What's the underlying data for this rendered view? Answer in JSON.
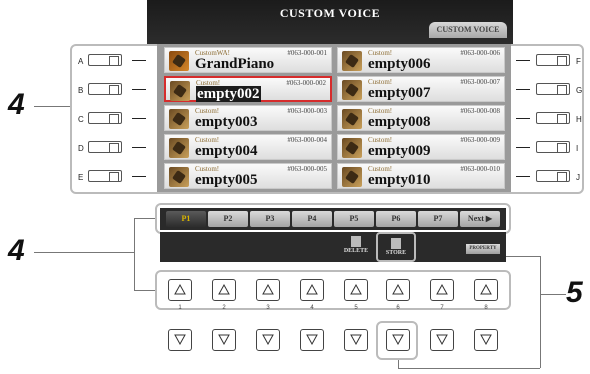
{
  "screen": {
    "title": "CUSTOM VOICE",
    "tab": "CUSTOM VOICE"
  },
  "callouts": {
    "left_top": "4",
    "left_bottom": "4",
    "right": "5"
  },
  "side_buttons": {
    "left": [
      "A",
      "B",
      "C",
      "D",
      "E"
    ],
    "right": [
      "F",
      "G",
      "H",
      "I",
      "J"
    ]
  },
  "voices": [
    {
      "bank": "CustomWA!",
      "number": "#063-000-001",
      "name": "GrandPiano",
      "selected": false,
      "icon": "grand-piano-icon"
    },
    {
      "bank": "Custom!",
      "number": "#063-000-002",
      "name": "empty002",
      "selected": true,
      "icon": "guitar-icon"
    },
    {
      "bank": "Custom!",
      "number": "#063-000-003",
      "name": "empty003",
      "selected": false,
      "icon": "guitar-icon"
    },
    {
      "bank": "Custom!",
      "number": "#063-000-004",
      "name": "empty004",
      "selected": false,
      "icon": "guitar-icon"
    },
    {
      "bank": "Custom!",
      "number": "#063-000-005",
      "name": "empty005",
      "selected": false,
      "icon": "guitar-icon"
    },
    {
      "bank": "Custom!",
      "number": "#063-000-006",
      "name": "empty006",
      "selected": false,
      "icon": "guitar-icon"
    },
    {
      "bank": "Custom!",
      "number": "#063-000-007",
      "name": "empty007",
      "selected": false,
      "icon": "guitar-icon"
    },
    {
      "bank": "Custom!",
      "number": "#063-000-008",
      "name": "empty008",
      "selected": false,
      "icon": "guitar-icon"
    },
    {
      "bank": "Custom!",
      "number": "#063-000-009",
      "name": "empty009",
      "selected": false,
      "icon": "guitar-icon"
    },
    {
      "bank": "Custom!",
      "number": "#063-000-010",
      "name": "empty010",
      "selected": false,
      "icon": "guitar-icon"
    }
  ],
  "pages": [
    "P1",
    "P2",
    "P3",
    "P4",
    "P5",
    "P6",
    "P7",
    "Next ▶"
  ],
  "active_page": "P1",
  "functions": {
    "delete": "DELETE",
    "store": "STORE",
    "property": "PROPERTY"
  },
  "hardware_buttons": {
    "numbers": [
      "1",
      "2",
      "3",
      "4",
      "5",
      "6",
      "7",
      "8"
    ],
    "up_symbol": "up-triangle-icon",
    "down_symbol": "down-triangle-icon"
  }
}
